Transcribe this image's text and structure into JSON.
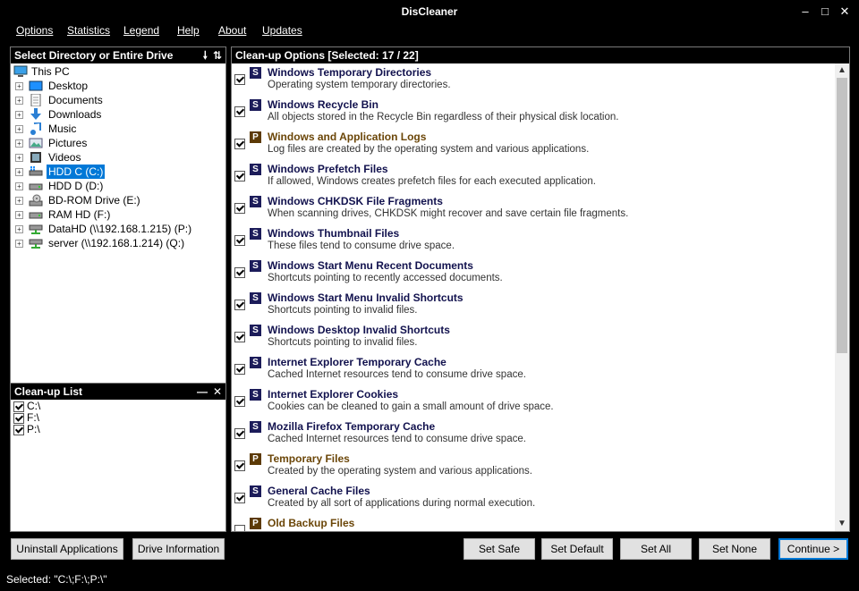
{
  "window": {
    "title": "DisCleaner"
  },
  "menu": [
    "Options",
    "Statistics",
    "Legend",
    "Help",
    "About",
    "Updates"
  ],
  "dir_panel": {
    "title": "Select Directory or Entire Drive",
    "icons": [
      "arrow-down-icon",
      "sort-icon"
    ],
    "tree": [
      {
        "label": "This PC",
        "icon": "pc",
        "root": true
      },
      {
        "label": "Desktop",
        "icon": "desktop"
      },
      {
        "label": "Documents",
        "icon": "doc"
      },
      {
        "label": "Downloads",
        "icon": "download"
      },
      {
        "label": "Music",
        "icon": "music"
      },
      {
        "label": "Pictures",
        "icon": "pictures"
      },
      {
        "label": "Videos",
        "icon": "video"
      },
      {
        "label": "HDD C (C:)",
        "icon": "drivewin",
        "selected": true
      },
      {
        "label": "HDD D (D:)",
        "icon": "drive"
      },
      {
        "label": "BD-ROM Drive (E:)",
        "icon": "optical"
      },
      {
        "label": "RAM HD (F:)",
        "icon": "drive"
      },
      {
        "label": "DataHD (\\\\192.168.1.215) (P:)",
        "icon": "netdrive"
      },
      {
        "label": "server (\\\\192.168.1.214) (Q:)",
        "icon": "netdrive"
      }
    ]
  },
  "cleanup_list": {
    "title": "Clean-up List",
    "items": [
      {
        "label": "C:\\",
        "checked": true
      },
      {
        "label": "F:\\",
        "checked": true
      },
      {
        "label": "P:\\",
        "checked": true
      }
    ]
  },
  "options_panel": {
    "title": "Clean-up Options [Selected: 17 / 22]",
    "options": [
      {
        "badge": "S",
        "name": "Windows Temporary Directories",
        "desc": "Operating system temporary directories.",
        "checked": true
      },
      {
        "badge": "S",
        "name": "Windows Recycle Bin",
        "desc": "All objects stored in the Recycle Bin regardless of their physical disk location.",
        "checked": true
      },
      {
        "badge": "P",
        "name": "Windows and Application Logs",
        "desc": "Log files are created by the operating system and various applications.",
        "checked": true
      },
      {
        "badge": "S",
        "name": "Windows Prefetch Files",
        "desc": "If allowed, Windows creates prefetch files for each executed application.",
        "checked": true
      },
      {
        "badge": "S",
        "name": "Windows CHKDSK File Fragments",
        "desc": "When scanning drives, CHKDSK might recover and save certain file fragments.",
        "checked": true
      },
      {
        "badge": "S",
        "name": "Windows Thumbnail Files",
        "desc": "These files tend to consume drive space.",
        "checked": true
      },
      {
        "badge": "S",
        "name": "Windows Start Menu Recent Documents",
        "desc": "Shortcuts pointing to recently accessed documents.",
        "checked": true
      },
      {
        "badge": "S",
        "name": "Windows Start Menu Invalid Shortcuts",
        "desc": "Shortcuts pointing to invalid files.",
        "checked": true
      },
      {
        "badge": "S",
        "name": "Windows Desktop Invalid Shortcuts",
        "desc": "Shortcuts pointing to invalid files.",
        "checked": true
      },
      {
        "badge": "S",
        "name": "Internet Explorer Temporary Cache",
        "desc": "Cached Internet resources tend to consume drive space.",
        "checked": true
      },
      {
        "badge": "S",
        "name": "Internet Explorer Cookies",
        "desc": "Cookies can be cleaned to gain a small amount of drive space.",
        "checked": true
      },
      {
        "badge": "S",
        "name": "Mozilla Firefox Temporary Cache",
        "desc": "Cached Internet resources tend to consume drive space.",
        "checked": true
      },
      {
        "badge": "P",
        "name": "Temporary Files",
        "desc": "Created by the operating system and various applications.",
        "checked": true
      },
      {
        "badge": "S",
        "name": "General Cache Files",
        "desc": "Created by all sort of applications during normal execution.",
        "checked": true
      },
      {
        "badge": "P",
        "name": "Old Backup Files",
        "desc": "",
        "checked": false
      }
    ],
    "scroll_fraction": 0.0
  },
  "buttons": {
    "uninstall": "Uninstall Applications",
    "drive_info": "Drive Information",
    "set_safe": "Set Safe",
    "set_default": "Set Default",
    "set_all": "Set All",
    "set_none": "Set None",
    "continue": "Continue >"
  },
  "status": {
    "text": "Selected: \"C:\\;F:\\;P:\\\""
  },
  "colors": {
    "accent": "#0078d7",
    "system_badge": "#1c1c5a",
    "program_badge": "#5c3a06"
  }
}
